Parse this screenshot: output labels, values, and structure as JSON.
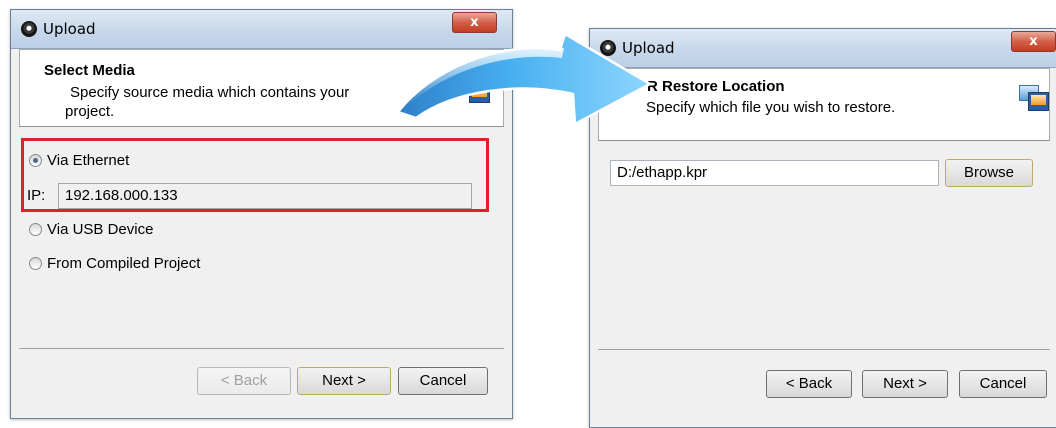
{
  "left_dialog": {
    "title": "Upload",
    "close_label": "x",
    "header": {
      "title": "Select Media",
      "description_line1": "Specify source media which contains your",
      "description_line2": "project."
    },
    "options": [
      {
        "label": "Via Ethernet",
        "checked": true
      },
      {
        "label": "Via USB Device",
        "checked": false
      },
      {
        "label": "From Compiled Project",
        "checked": false
      }
    ],
    "ip": {
      "label": "IP:",
      "value": "192.168.000.133"
    },
    "buttons": {
      "back": "< Back",
      "next": "Next >",
      "cancel": "Cancel"
    }
  },
  "right_dialog": {
    "title": "Upload",
    "close_label": "x",
    "header": {
      "title": "PR Restore Location",
      "description": "Specify which file you wish to restore."
    },
    "file_path": "D:/ethapp.kpr",
    "browse_label": "Browse",
    "buttons": {
      "back": "< Back",
      "next": "Next >",
      "cancel": "Cancel"
    }
  },
  "colors": {
    "highlight": "#e0202a",
    "arrow": "#3aa3e8"
  }
}
